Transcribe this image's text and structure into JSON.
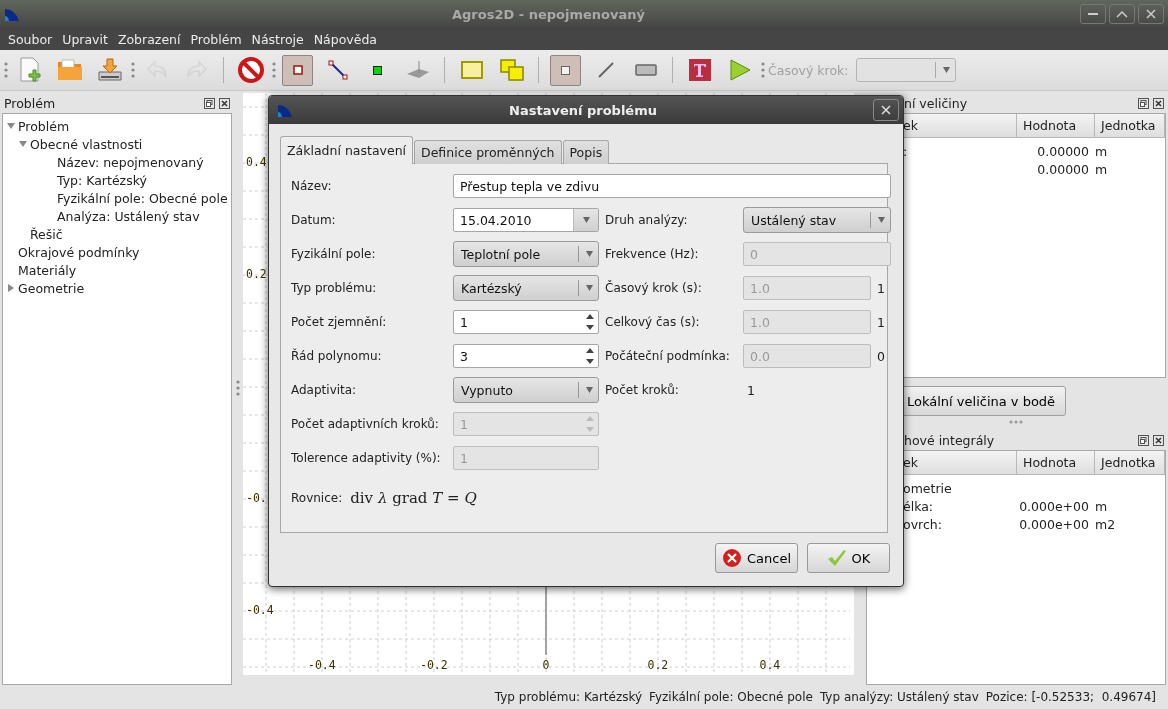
{
  "window": {
    "title": "Agros2D - nepojmenovaný"
  },
  "menu": [
    "Soubor",
    "Upravit",
    "Zobrazení",
    "Problém",
    "Nástroje",
    "Nápověda"
  ],
  "toolbar": {
    "groups": [
      {
        "kind": "grip",
        "buttons": [
          {
            "kind": "new",
            "selected": false,
            "disabled": false
          },
          {
            "kind": "open",
            "selected": false,
            "disabled": false
          },
          {
            "kind": "save",
            "selected": false,
            "disabled": false
          }
        ]
      },
      {
        "kind": "grip",
        "buttons": [
          {
            "kind": "undo",
            "selected": false,
            "disabled": true
          },
          {
            "kind": "redo",
            "selected": false,
            "disabled": true
          }
        ]
      },
      {
        "kind": "separator",
        "buttons": [
          {
            "kind": "stop",
            "selected": false,
            "disabled": false
          }
        ]
      },
      {
        "kind": "grip",
        "buttons": [
          {
            "kind": "node",
            "selected": true,
            "disabled": false
          },
          {
            "kind": "edge",
            "selected": false,
            "disabled": false
          },
          {
            "kind": "label",
            "selected": false,
            "disabled": false
          },
          {
            "kind": "scene",
            "selected": false,
            "disabled": false
          }
        ]
      },
      {
        "kind": "separator",
        "buttons": [
          {
            "kind": "box",
            "selected": false,
            "disabled": false
          },
          {
            "kind": "boxes",
            "selected": false,
            "disabled": false
          }
        ]
      },
      {
        "kind": "separator",
        "buttons": [
          {
            "kind": "point",
            "selected": true,
            "disabled": false
          },
          {
            "kind": "line",
            "selected": false,
            "disabled": false
          },
          {
            "kind": "rect",
            "selected": false,
            "disabled": false
          }
        ]
      },
      {
        "kind": "separator",
        "buttons": [
          {
            "kind": "text",
            "selected": false,
            "disabled": false
          },
          {
            "kind": "play",
            "selected": false,
            "disabled": false
          }
        ]
      }
    ],
    "time_step": {
      "label": "Časový krok:",
      "disabled": true
    }
  },
  "left_dock": {
    "title": "Problém",
    "tree": [
      {
        "label": "Problém",
        "expanded": true,
        "children": [
          {
            "label": "Obecné vlastnosti",
            "expanded": true,
            "children": [
              {
                "label": "Název: nepojmenovaný"
              },
              {
                "label": "Typ: Kartézský"
              },
              {
                "label": "Fyzikální pole: Obecné pole"
              },
              {
                "label": "Analýza: Ustálený stav"
              }
            ]
          },
          {
            "label": "Řešič"
          }
        ]
      },
      {
        "label": "Okrajové podmínky"
      },
      {
        "label": "Materiály"
      },
      {
        "label": "Geometrie",
        "expanded": false
      }
    ]
  },
  "plot": {
    "y_labels": [
      "0.4",
      "0.2",
      "-0.",
      "-0.4"
    ],
    "x_labels": [
      "-0.4",
      "-0.2",
      "0",
      "0.2",
      "0.4"
    ]
  },
  "right_dock": {
    "panels": [
      {
        "title": "ní veličiny",
        "columns": [
          "ek",
          "Hodnota",
          "Jednotka"
        ],
        "rows": [
          {
            "name": ":",
            "value": "0.00000",
            "unit": "m"
          },
          {
            "value": "0.00000",
            "unit": "m"
          }
        ],
        "button": "Lokální veličina v bodě"
      },
      {
        "title": "hové integrály",
        "columns": [
          "ek",
          "Hodnota",
          "Jednotka"
        ],
        "rows": [
          {
            "name": "ometrie"
          },
          {
            "name": "élka:",
            "value": "0.000e+00",
            "unit": "m"
          },
          {
            "name": "ovrch:",
            "value": "0.000e+00",
            "unit": "m2"
          }
        ]
      }
    ]
  },
  "status_bar": [
    "Typ problému: Kartézský",
    "Fyzikální pole: Obecné pole",
    "Typ analýzy: Ustálený stav",
    "Pozice: [-0.52533;  0.49674]"
  ],
  "dialog": {
    "title": "Nastavení problému",
    "tabs": [
      {
        "label": "Základní nastavení",
        "selected": true
      },
      {
        "label": "Definice proměnných",
        "selected": false
      },
      {
        "label": "Popis",
        "selected": false
      }
    ],
    "name_field": {
      "label": "Název:",
      "value": "Přestup tepla ve zdivu"
    },
    "rows": [
      {
        "left": {
          "label": "Datum:",
          "kind": "date",
          "value": "15.04.2010",
          "disabled": false
        },
        "right": {
          "label": "Druh analýzy:",
          "kind": "combo",
          "value": "Ustálený stav",
          "disabled": false
        }
      },
      {
        "left": {
          "label": "Fyzikální pole:",
          "kind": "combo",
          "value": "Teplotní pole",
          "disabled": false
        },
        "right": {
          "label": "Frekvence (Hz):",
          "kind": "text",
          "value": "0",
          "disabled": true
        }
      },
      {
        "left": {
          "label": "Typ problému:",
          "kind": "combo",
          "value": "Kartézský",
          "disabled": false
        },
        "right": {
          "label": "Časový krok (s):",
          "kind": "text",
          "value": "1.0",
          "disabled": true,
          "suffix": "1"
        }
      },
      {
        "left": {
          "label": "Počet zjemnění:",
          "kind": "spin",
          "value": "1",
          "disabled": false
        },
        "right": {
          "label": "Celkový čas (s):",
          "kind": "text",
          "value": "1.0",
          "disabled": true,
          "suffix": "1"
        }
      },
      {
        "left": {
          "label": "Řád polynomu:",
          "kind": "spin",
          "value": "3",
          "disabled": false
        },
        "right": {
          "label": "Počáteční podmínka:",
          "kind": "text",
          "value": "0.0",
          "disabled": true,
          "suffix": "0"
        }
      },
      {
        "left": {
          "label": "Adaptivita:",
          "kind": "combo",
          "value": "Vypnuto",
          "disabled": false
        },
        "right": {
          "label": "Počet kroků:",
          "kind": "value",
          "value": "1",
          "disabled": false
        }
      },
      {
        "left": {
          "label": "Počet adaptivních kroků:",
          "kind": "spin",
          "value": "1",
          "disabled": true
        }
      },
      {
        "left": {
          "label": "Tolerence adaptivity (%):",
          "kind": "text",
          "value": "1",
          "disabled": true
        }
      }
    ],
    "equation": {
      "label": "Rovnice:",
      "formula": "div *λ* grad *T* = *Q*"
    },
    "buttons": [
      {
        "kind": "cancel",
        "label": "Cancel"
      },
      {
        "kind": "ok",
        "label": "OK"
      }
    ]
  }
}
